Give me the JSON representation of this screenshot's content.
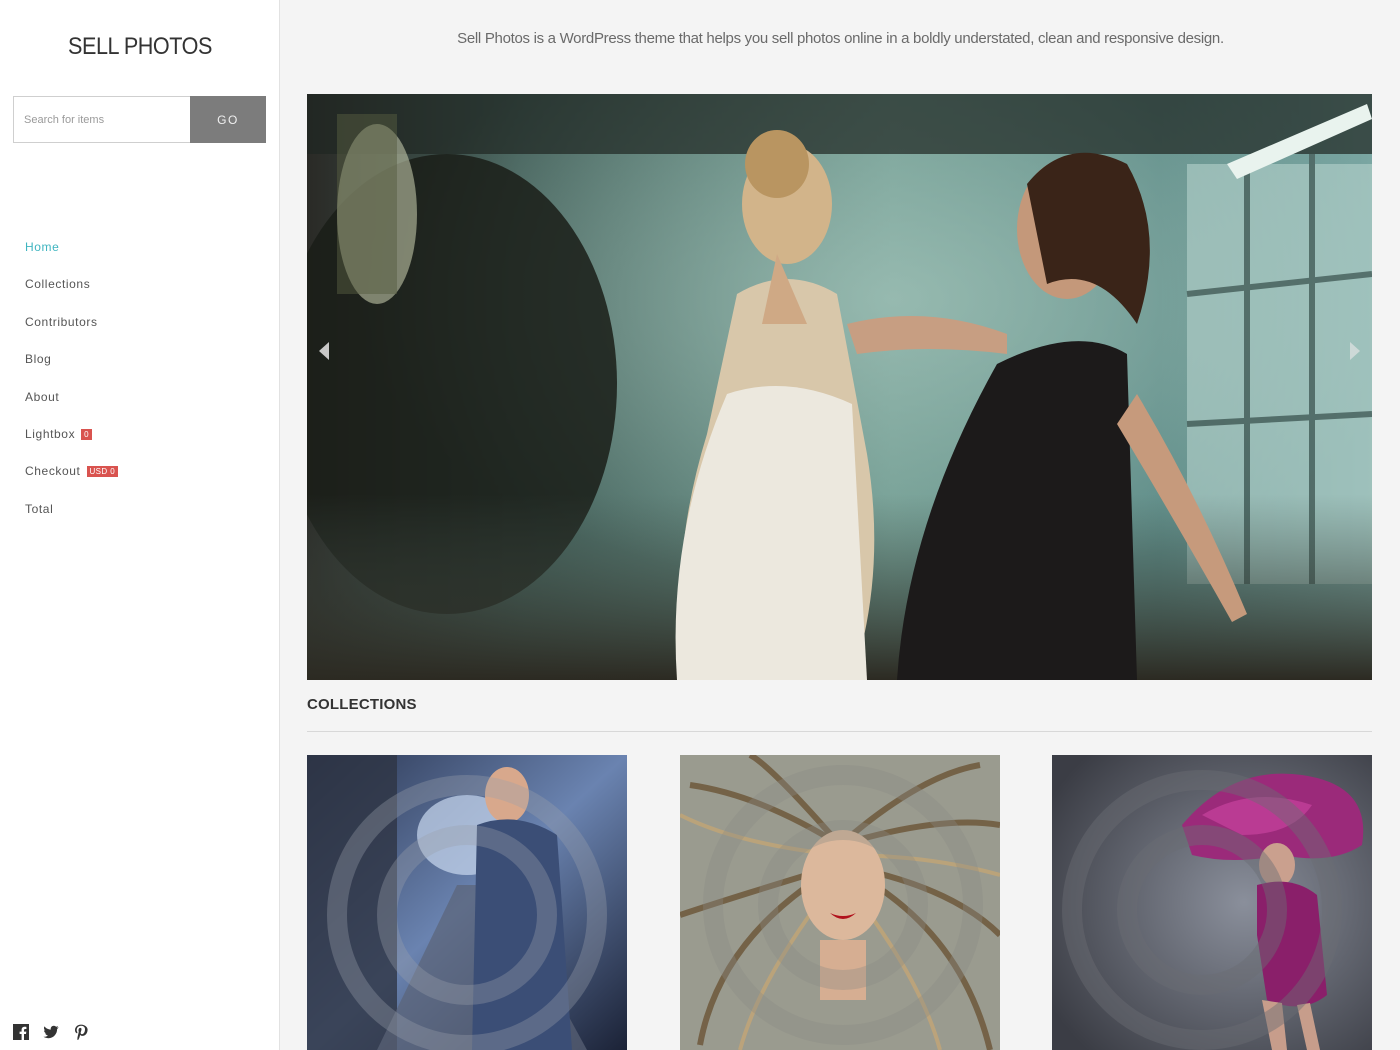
{
  "sidebar": {
    "site_title": "SELL PHOTOS",
    "search": {
      "placeholder": "Search for items",
      "button_label": "GO"
    },
    "nav": [
      {
        "label": "Home",
        "active": true
      },
      {
        "label": "Collections"
      },
      {
        "label": "Contributors"
      },
      {
        "label": "Blog"
      },
      {
        "label": "About"
      },
      {
        "label": "Lightbox",
        "badge": "0"
      },
      {
        "label": "Checkout",
        "badge": "USD 0"
      },
      {
        "label": "Total"
      }
    ],
    "social": [
      "facebook-icon",
      "twitter-icon",
      "pinterest-icon"
    ]
  },
  "main": {
    "tagline": "Sell Photos is a WordPress theme that helps you sell photos online in a boldly understated, clean and responsive design.",
    "collections_heading": "COLLECTIONS"
  },
  "colors": {
    "accent": "#3fb5c0",
    "badge": "#d9534f",
    "go_button": "#7c7c7c"
  }
}
